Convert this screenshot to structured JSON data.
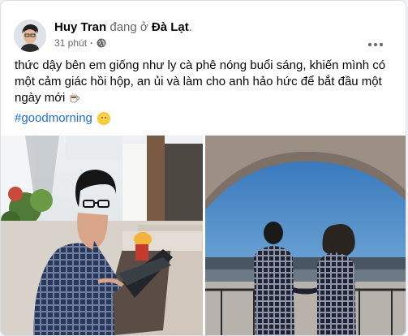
{
  "post": {
    "author": "Huy Tran",
    "at_text": "đang ở",
    "location": "Đà Lạt",
    "location_suffix": ".",
    "time": "31 phút",
    "dot": "·",
    "privacy_icon": "globe-icon",
    "more_icon": "more-dots-icon",
    "text": "thức dậy bên em giống như ly cà phê nóng buổi sáng, khiến mình có một cảm giác hồi hộp, an ủi và làm cho anh hảo hức để bắt đầu một ngày mới",
    "text_emoji_icon": "hot-beverage-icon",
    "hashtag": "#goodmorning",
    "hashtag_emoji_icon": "smiling-sun-icon",
    "photos": [
      {
        "icon": "photo-man-at-laptop"
      },
      {
        "icon": "photo-couple-on-balcony"
      }
    ]
  },
  "colors": {
    "hashtag": "#216fdb",
    "secondary_text": "#65676b",
    "card_bg": "#ffffff"
  }
}
